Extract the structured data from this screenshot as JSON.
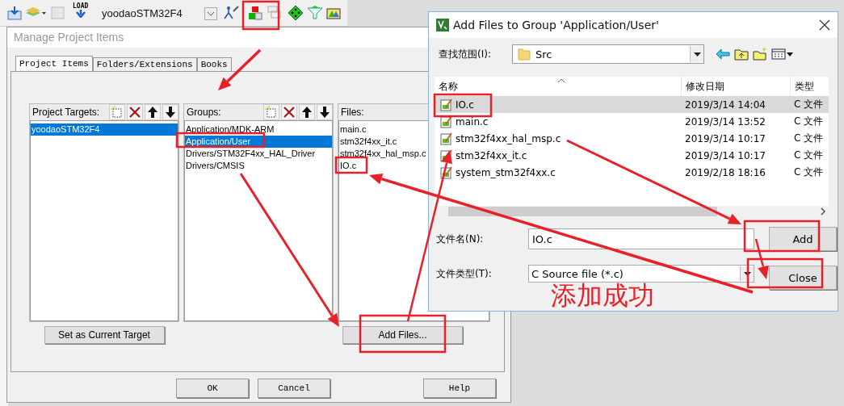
{
  "toolbar": {
    "load_label": "LOAD",
    "target": "yoodaoSTM32F4"
  },
  "manage_dialog": {
    "title": "Manage Project Items",
    "tabs": [
      {
        "label": "Project Items",
        "selected": true
      },
      {
        "label": "Folders/Extensions",
        "selected": false
      },
      {
        "label": "Books",
        "selected": false
      }
    ],
    "panels": [
      {
        "heading": "Project Targets:",
        "tools": true,
        "button": "Set as Current Target",
        "items": [
          {
            "label": "yoodaoSTM32F4",
            "selected": true
          }
        ]
      },
      {
        "heading": "Groups:",
        "tools": true,
        "items": [
          {
            "label": "Application/MDK-ARM",
            "selected": false
          },
          {
            "label": "Application/User",
            "selected": true
          },
          {
            "label": "Drivers/STM32F4xx_HAL_Driver",
            "selected": false
          },
          {
            "label": "Drivers/CMSIS",
            "selected": false
          }
        ]
      },
      {
        "heading": "Files:",
        "tools": false,
        "button": "Add Files...",
        "items": [
          {
            "label": "main.c",
            "selected": false
          },
          {
            "label": "stm32f4xx_it.c",
            "selected": false
          },
          {
            "label": "stm32f4xx_hal_msp.c",
            "selected": false
          },
          {
            "label": "IO.c",
            "selected": false
          }
        ]
      }
    ],
    "buttons": [
      "OK",
      "Cancel",
      "Help"
    ]
  },
  "add_files_dialog": {
    "title": "Add Files to Group 'Application/User'",
    "look_in_label": "查找范围(I):",
    "look_in": "Src",
    "columns": [
      "名称",
      "修改日期",
      "类型"
    ],
    "files": [
      {
        "name": "IO.c",
        "date": "2019/3/14 14:04",
        "type": "C 文件",
        "selected": true
      },
      {
        "name": "main.c",
        "date": "2019/3/14 13:52",
        "type": "C 文件",
        "selected": false
      },
      {
        "name": "stm32f4xx_hal_msp.c",
        "date": "2019/3/14 10:17",
        "type": "C 文件",
        "selected": false
      },
      {
        "name": "stm32f4xx_it.c",
        "date": "2019/3/14 10:17",
        "type": "C 文件",
        "selected": false
      },
      {
        "name": "system_stm32f4xx.c",
        "date": "2019/2/18 18:16",
        "type": "C 文件",
        "selected": false
      }
    ],
    "file_name_label": "文件名(N):",
    "file_name": "IO.c",
    "file_type_label": "文件类型(T):",
    "file_type": "C Source file (*.c)",
    "buttons": [
      "Add",
      "Close"
    ]
  },
  "annotation": {
    "text": "添加成功"
  }
}
